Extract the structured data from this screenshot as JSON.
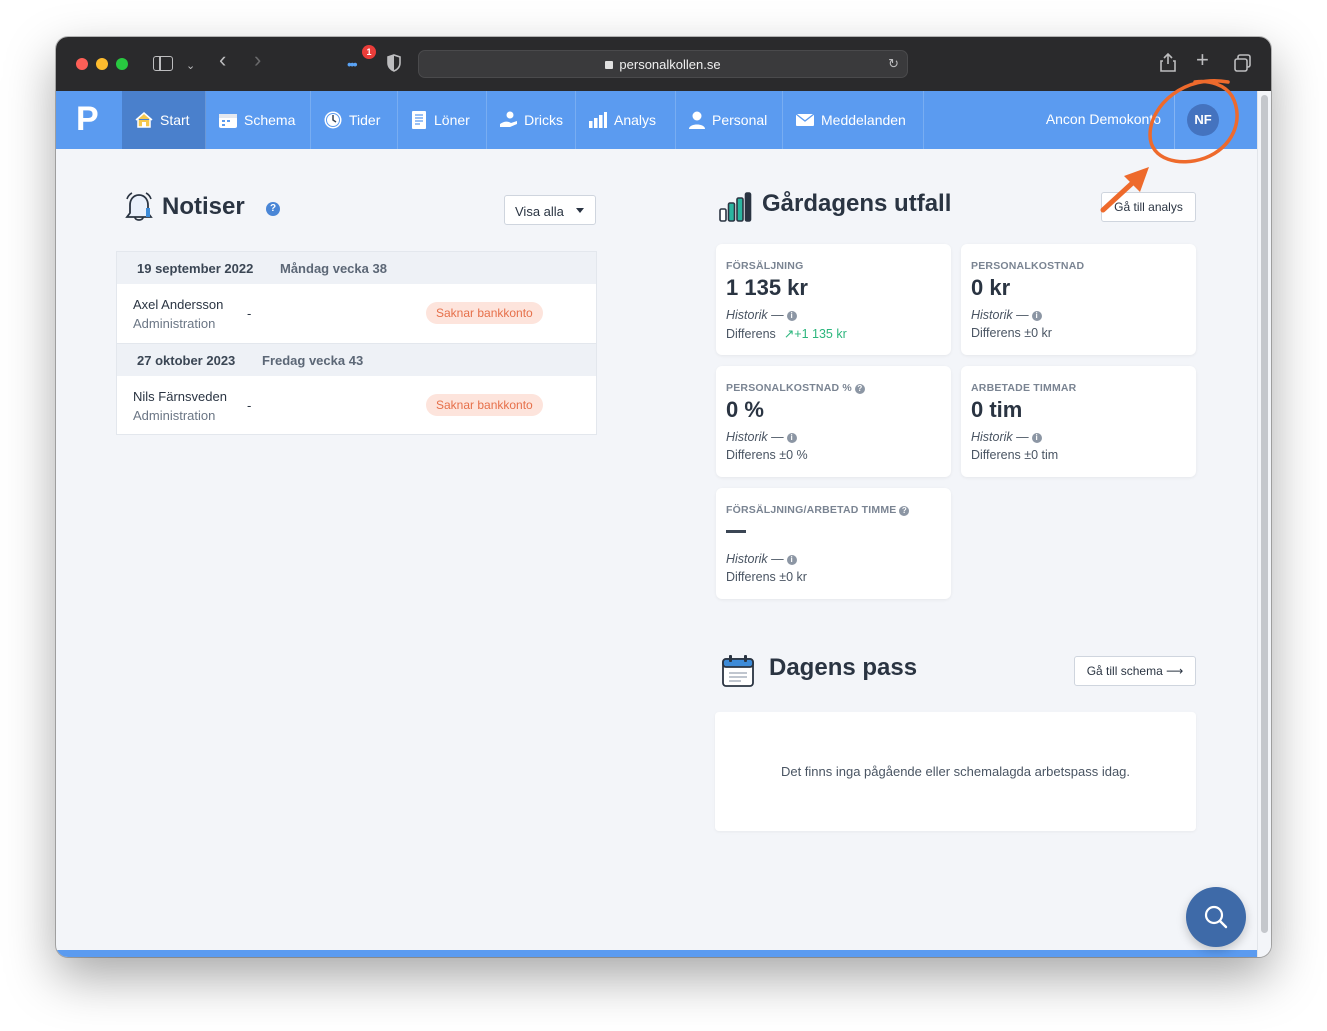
{
  "browser": {
    "url": "personalkollen.se",
    "extension_badge": "1"
  },
  "nav": {
    "logo": "P",
    "items": [
      {
        "label": "Start",
        "icon": "house-icon"
      },
      {
        "label": "Schema",
        "icon": "calendar-icon"
      },
      {
        "label": "Tider",
        "icon": "clock-icon"
      },
      {
        "label": "Löner",
        "icon": "document-icon"
      },
      {
        "label": "Dricks",
        "icon": "hand-coin-icon"
      },
      {
        "label": "Analys",
        "icon": "bar-chart-icon"
      },
      {
        "label": "Personal",
        "icon": "person-icon"
      },
      {
        "label": "Meddelanden",
        "icon": "envelope-icon"
      }
    ],
    "company": "Ancon Demokonto",
    "avatar": "NF",
    "active_color": "#4a80cc",
    "bar_color": "#5b9bf0"
  },
  "notiser": {
    "title": "Notiser",
    "help": "?",
    "filter": "Visa alla",
    "groups": [
      {
        "date": "19 september 2022",
        "week": "Måndag vecka 38",
        "person": "Axel Andersson",
        "role": "Administration",
        "dash": "-",
        "badge": "Saknar bankkonto"
      },
      {
        "date": "27 oktober 2023",
        "week": "Fredag vecka 43",
        "person": "Nils Färnsveden",
        "role": "Administration",
        "dash": "-",
        "badge": "Saknar bankkonto"
      }
    ]
  },
  "utfall": {
    "title": "Gårdagens utfall",
    "button": "Gå till analys",
    "stats": [
      {
        "label": "FÖRSÄLJNING",
        "value": "1 135 kr",
        "history": "Historik —",
        "diff_label": "Differens",
        "diff_value": "+1 135 kr"
      },
      {
        "label": "PERSONALKOSTNAD",
        "value": "0 kr",
        "history": "Historik —",
        "diff_label": "Differens ±0 kr",
        "diff_value": ""
      },
      {
        "label": "PERSONALKOSTNAD %",
        "value": "0 %",
        "history": "Historik —",
        "diff_label": "Differens ±0 %",
        "diff_value": ""
      },
      {
        "label": "ARBETADE TIMMAR",
        "value": "0 tim",
        "history": "Historik —",
        "diff_label": "Differens ±0 tim",
        "diff_value": ""
      },
      {
        "label": "FÖRSÄLJNING/ARBETAD TIMME",
        "value": "",
        "history": "Historik —",
        "diff_label": "Differens ±0 kr",
        "diff_value": ""
      }
    ]
  },
  "pass": {
    "title": "Dagens pass",
    "button": "Gå till schema ⟶",
    "empty": "Det finns inga pågående eller schemalagda arbetspass idag."
  },
  "annotation_color": "#ee6a2c"
}
